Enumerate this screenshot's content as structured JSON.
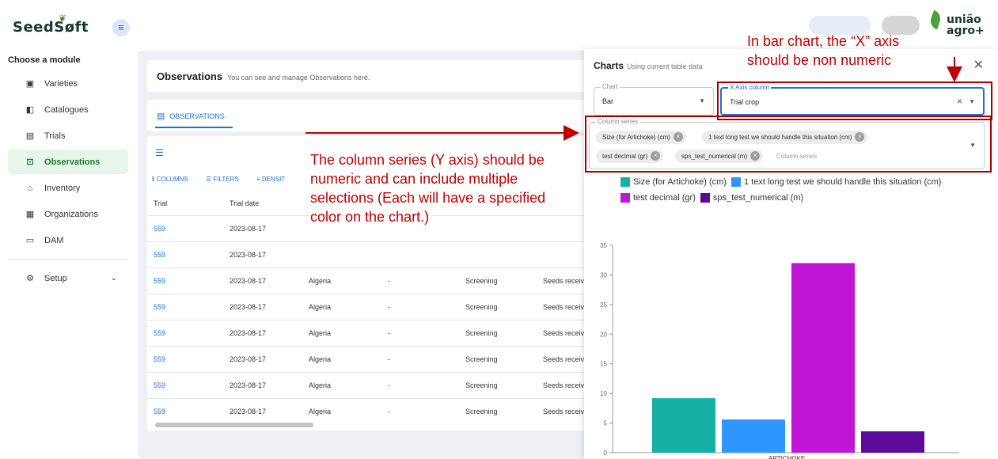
{
  "header": {
    "logo": "SeedSøft",
    "brand": "união agro+"
  },
  "sidebar": {
    "title": "Choose a module",
    "items": [
      {
        "label": "Varieties",
        "icon": "varieties-icon"
      },
      {
        "label": "Catalogues",
        "icon": "catalogue-icon"
      },
      {
        "label": "Trials",
        "icon": "trials-icon"
      },
      {
        "label": "Observations",
        "icon": "observations-icon"
      },
      {
        "label": "Inventory",
        "icon": "inventory-icon"
      },
      {
        "label": "Organizations",
        "icon": "organizations-icon"
      },
      {
        "label": "DAM",
        "icon": "folder-icon"
      }
    ],
    "setup": "Setup"
  },
  "main": {
    "title": "Observations",
    "subtitle": "You can see and manage Observations here.",
    "tab": "OBSERVATIONS",
    "toolbar": {
      "columns": "COLUMNS",
      "filters": "FILTERS",
      "density": "DENSIT"
    },
    "columns": [
      "Trial",
      "Trial date"
    ],
    "rows": [
      {
        "trial": "559",
        "date": "2023-08-17",
        "country": "",
        "dash": "",
        "type": "",
        "status": ""
      },
      {
        "trial": "559",
        "date": "2023-08-17",
        "country": "",
        "dash": "",
        "type": "",
        "status": ""
      },
      {
        "trial": "559",
        "date": "2023-08-17",
        "country": "Algeria",
        "dash": "-",
        "type": "Screening",
        "status": "Seeds receiv"
      },
      {
        "trial": "559",
        "date": "2023-08-17",
        "country": "Algeria",
        "dash": "-",
        "type": "Screening",
        "status": "Seeds receiv"
      },
      {
        "trial": "559",
        "date": "2023-08-17",
        "country": "Algeria",
        "dash": "-",
        "type": "Screening",
        "status": "Seeds receiv"
      },
      {
        "trial": "559",
        "date": "2023-08-17",
        "country": "Algeria",
        "dash": "-",
        "type": "Screening",
        "status": "Seeds receiv"
      },
      {
        "trial": "559",
        "date": "2023-08-17",
        "country": "Algeria",
        "dash": "-",
        "type": "Screening",
        "status": "Seeds receiv"
      },
      {
        "trial": "559",
        "date": "2023-08-17",
        "country": "Algeria",
        "dash": "-",
        "type": "Screening",
        "status": "Seeds receiv"
      }
    ]
  },
  "charts": {
    "title": "Charts",
    "subtitle": "Using current table data",
    "chart_label": "Chart",
    "chart_value": "Bar",
    "x_axis_label": "X Axis column",
    "x_axis_value": "Trial crop",
    "series_label": "Column series",
    "series_placeholder": "Column series",
    "chips": [
      "Size (for Artichoke) (cm)",
      "1 text long test we should handle this situation (cm)",
      "test decimal (gr)",
      "sps_test_numerical (m)"
    ]
  },
  "annotations": {
    "x_axis_note": "In bar chart, the “X” axis should be non numeric",
    "series_note": "The column series (Y axis) should be numeric and can include multiple selections (Each will have a specified color on the chart.)"
  },
  "colors": {
    "primary": "#1f6fd6",
    "active_green": "#1e7d32",
    "annotation_red": "#c00000"
  },
  "chart_data": {
    "type": "bar",
    "categories": [
      "ARTICHOKE"
    ],
    "series": [
      {
        "name": "Size (for Artichoke) (cm)",
        "values": [
          9.2
        ],
        "color": "#15b0a6"
      },
      {
        "name": "1 text long test we should handle this situation (cm)",
        "values": [
          5.6
        ],
        "color": "#2f95ff"
      },
      {
        "name": "test decimal (gr)",
        "values": [
          32
        ],
        "color": "#c016d6"
      },
      {
        "name": "sps_test_numerical (m)",
        "values": [
          3.6
        ],
        "color": "#5c0a9c"
      }
    ],
    "yticks": [
      "0",
      "5",
      "10",
      "15",
      "20",
      "25",
      "30",
      "35"
    ],
    "ylim": [
      0,
      35
    ]
  }
}
